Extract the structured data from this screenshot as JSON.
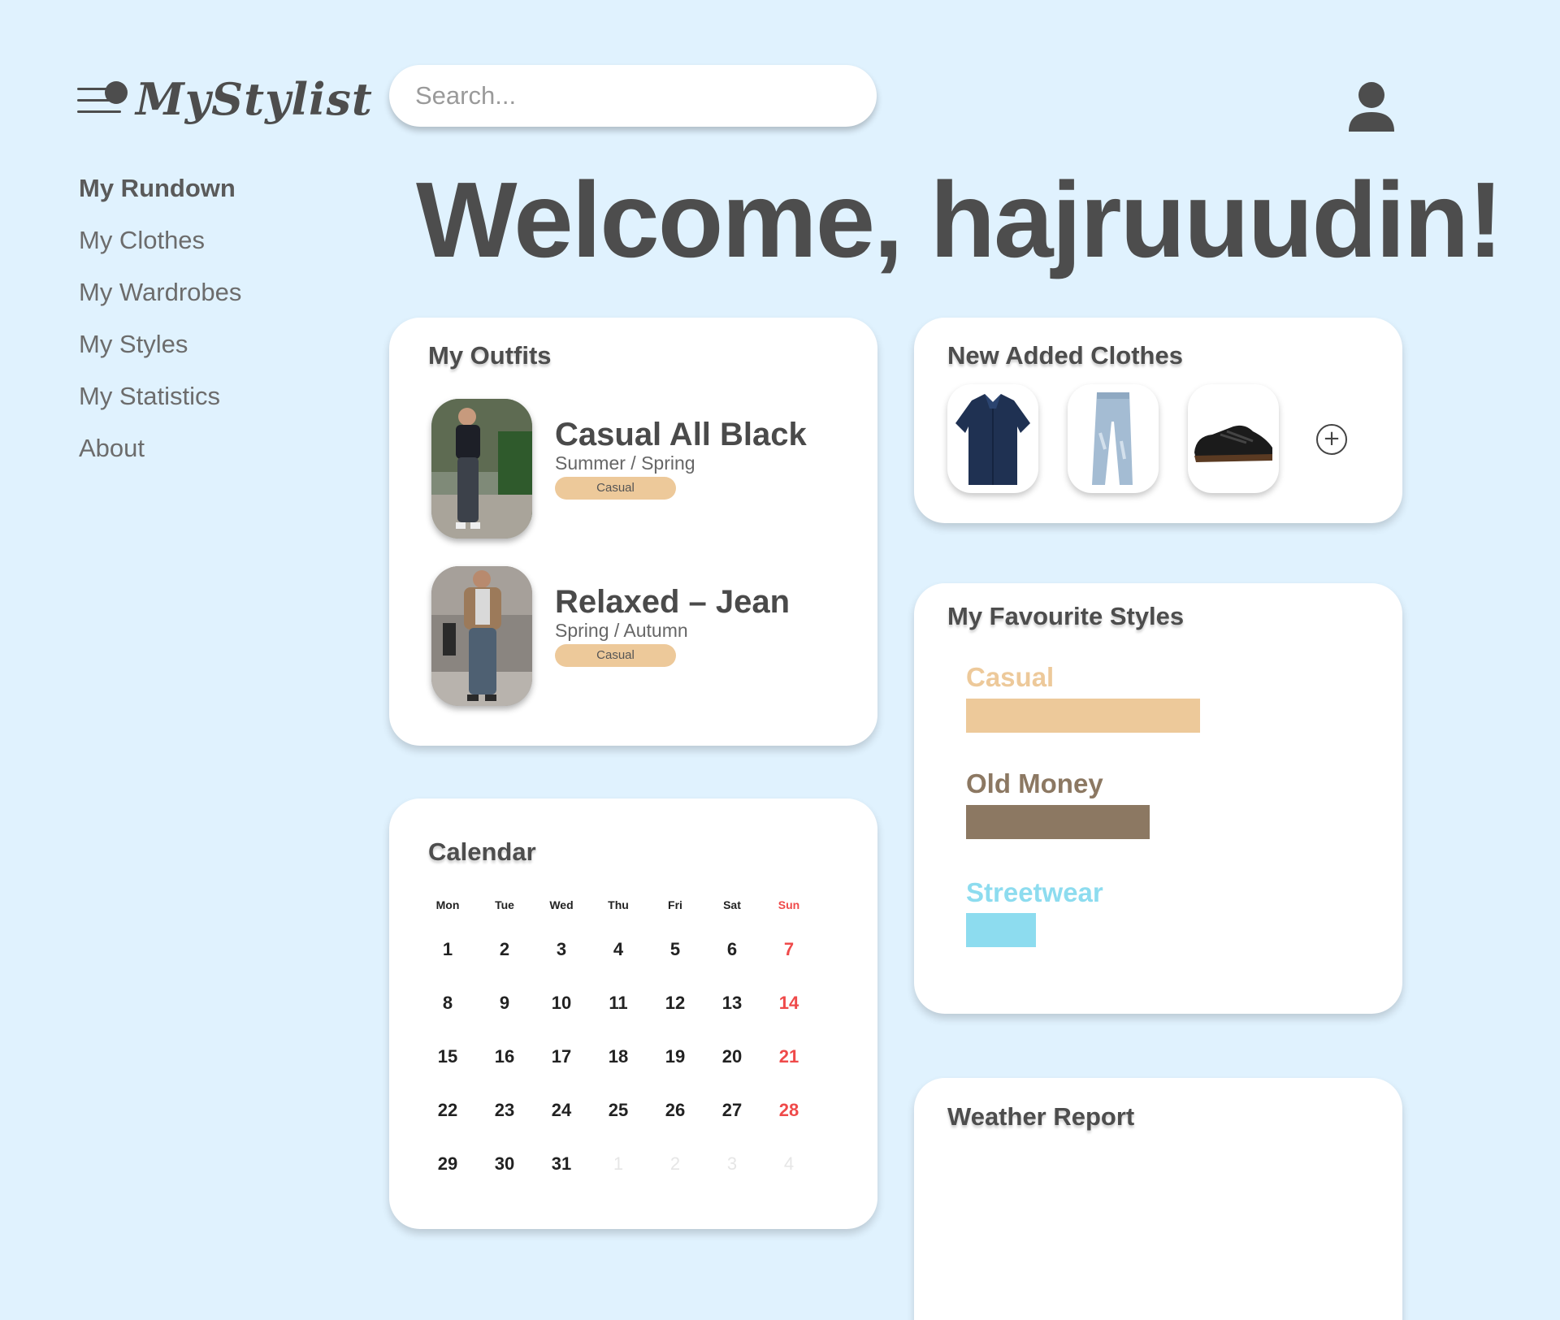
{
  "app": {
    "name": "MyStylist"
  },
  "search": {
    "placeholder": "Search..."
  },
  "sidebar": {
    "items": [
      {
        "label": "My Rundown",
        "active": true
      },
      {
        "label": "My Clothes",
        "active": false
      },
      {
        "label": "My Wardrobes",
        "active": false
      },
      {
        "label": "My Styles",
        "active": false
      },
      {
        "label": "My Statistics",
        "active": false
      },
      {
        "label": "About",
        "active": false
      }
    ]
  },
  "welcome": {
    "text": "Welcome,  hajruuudin!"
  },
  "outfits": {
    "title": "My Outfits",
    "items": [
      {
        "name": "Casual All Black",
        "season": "Summer / Spring",
        "tag": "Casual"
      },
      {
        "name": "Relaxed – Jean",
        "season": "Spring / Autumn",
        "tag": "Casual"
      }
    ]
  },
  "new_clothes": {
    "title": "New Added Clothes",
    "items": [
      {
        "icon": "navy-shirt-icon"
      },
      {
        "icon": "jeans-icon"
      },
      {
        "icon": "sneaker-icon"
      }
    ],
    "add_icon": "plus-circle-icon"
  },
  "favourite_styles": {
    "title": "My Favourite Styles",
    "styles": [
      {
        "name": "Casual",
        "share": 0.6,
        "color": "#edc99a"
      },
      {
        "name": "Old Money",
        "share": 0.47,
        "color": "#8c7862"
      },
      {
        "name": "Streetwear",
        "share": 0.18,
        "color": "#8ddcef"
      }
    ]
  },
  "calendar": {
    "title": "Calendar",
    "weekdays": [
      "Mon",
      "Tue",
      "Wed",
      "Thu",
      "Fri",
      "Sat",
      "Sun"
    ],
    "weeks": [
      [
        "1",
        "2",
        "3",
        "4",
        "5",
        "6",
        "7"
      ],
      [
        "8",
        "9",
        "10",
        "11",
        "12",
        "13",
        "14"
      ],
      [
        "15",
        "16",
        "17",
        "18",
        "19",
        "20",
        "21"
      ],
      [
        "22",
        "23",
        "24",
        "25",
        "26",
        "27",
        "28"
      ],
      [
        "29",
        "30",
        "31",
        "1",
        "2",
        "3",
        "4"
      ]
    ],
    "next_month_days": [
      "1",
      "2",
      "3",
      "4"
    ],
    "accent_color": "#ef4a4a"
  },
  "weather": {
    "title": "Weather Report"
  },
  "colors": {
    "background": "#e0f2fe",
    "text": "#4d4d4d",
    "tag": "#edc99a"
  }
}
